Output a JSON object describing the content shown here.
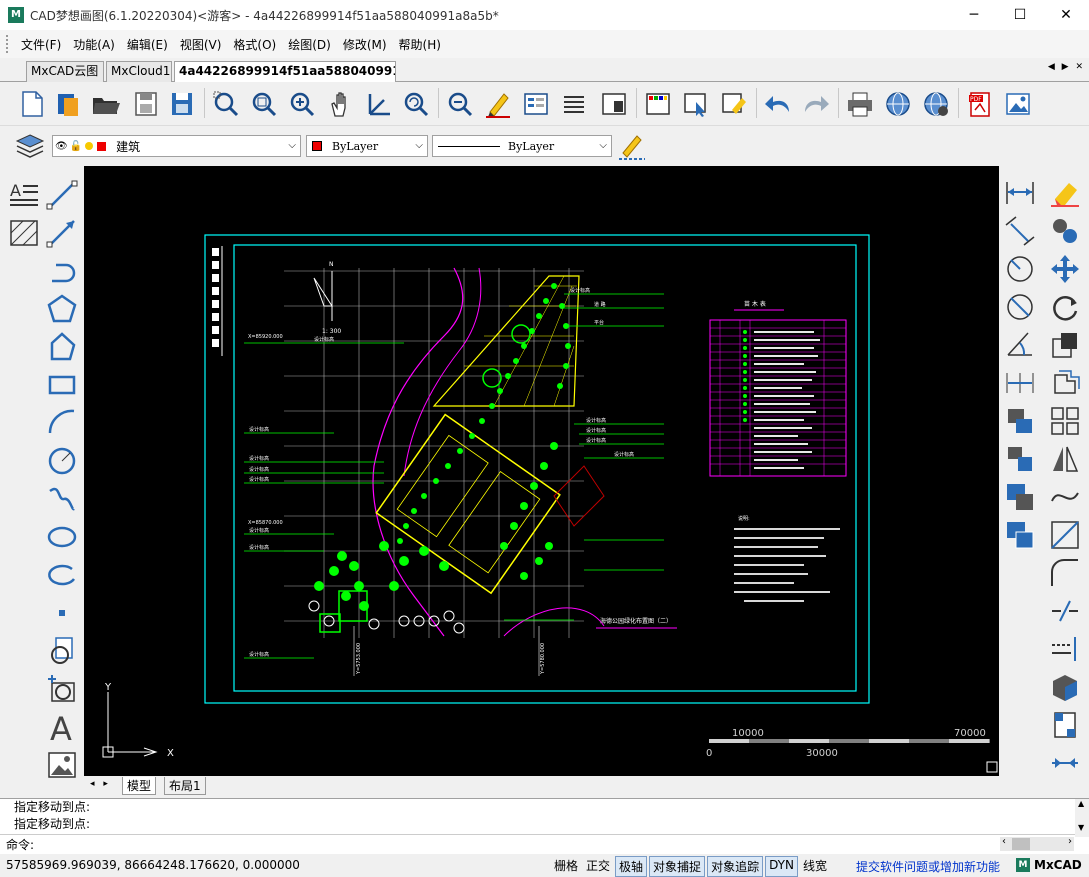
{
  "window": {
    "title": "CAD梦想画图(6.1.20220304)<游客> - 4a44226899914f51aa588040991a8a5b*",
    "minimize": "─",
    "maximize": "☐",
    "close": "✕"
  },
  "menu": [
    "文件(F)",
    "功能(A)",
    "编辑(E)",
    "视图(V)",
    "格式(O)",
    "绘图(D)",
    "修改(M)",
    "帮助(H)"
  ],
  "tabs": [
    {
      "label": "MxCAD云图",
      "active": false
    },
    {
      "label": "MxCloud1",
      "active": false
    },
    {
      "label": "4a44226899914f51aa588040991a...",
      "active": true
    }
  ],
  "tab_nav": "◀ ▶ ✕",
  "layer_bar": {
    "layer_name": "建筑",
    "color_value": "ByLayer",
    "linetype_value": "ByLayer"
  },
  "drawing": {
    "title_block": "海德公园绿化布置图（二）",
    "scale_label": "1: 300",
    "north_label": "N",
    "table_title": "苗 木 表",
    "notes_title": "说明:",
    "coord_y1": "X=85920.000",
    "coord_y2": "X=85870.000",
    "coord_x1": "Y=5753.000",
    "coord_x2": "Y=5780.000",
    "scalebar": [
      "10000",
      "70000",
      "0",
      "30000"
    ],
    "ucs_x": "X",
    "ucs_y": "Y"
  },
  "layout_tabs": [
    "模型",
    "布局1"
  ],
  "command": {
    "history": [
      "指定移动到点:",
      "指定移动到点:"
    ],
    "prompt": "命令:"
  },
  "status": {
    "coords": "57585969.969039,  86664248.176620,  0.000000",
    "toggles": [
      {
        "label": "栅格",
        "on": false
      },
      {
        "label": "正交",
        "on": false
      },
      {
        "label": "极轴",
        "on": true
      },
      {
        "label": "对象捕捉",
        "on": true
      },
      {
        "label": "对象追踪",
        "on": true
      },
      {
        "label": "DYN",
        "on": true
      },
      {
        "label": "线宽",
        "on": false
      }
    ],
    "feedback_link": "提交软件问题或增加新功能",
    "brand": "MxCAD"
  },
  "colors": {
    "canvas_bg": "#000000",
    "frame_cyan": "#00ffff",
    "magenta": "#ff00ff",
    "green": "#00ff00",
    "yellow": "#ffff00",
    "link_blue": "#0033cc"
  }
}
